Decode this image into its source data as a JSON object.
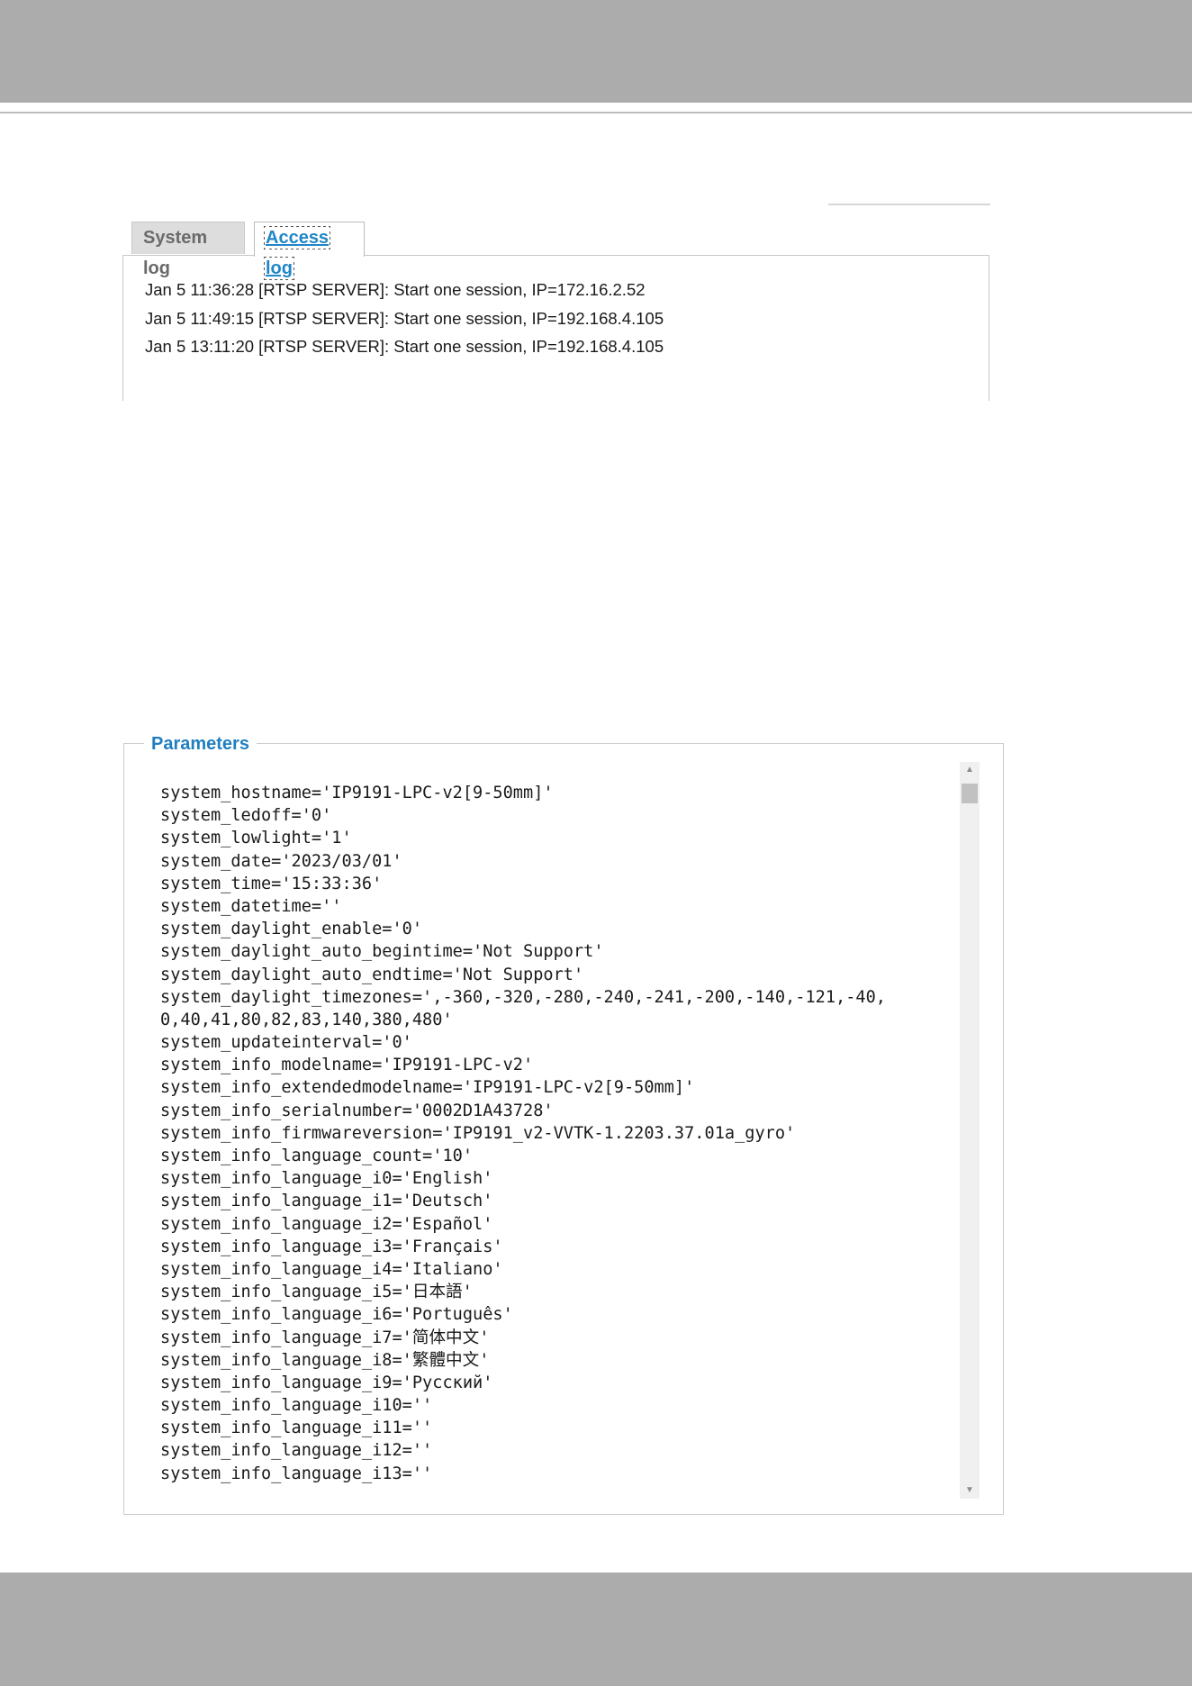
{
  "tabs": {
    "system_log": "System log",
    "access_log": "Access log"
  },
  "log_entries": [
    "Jan 5 11:36:28 [RTSP SERVER]: Start one session, IP=172.16.2.52",
    "Jan 5 11:49:15 [RTSP SERVER]: Start one session, IP=192.168.4.105",
    "Jan 5 13:11:20 [RTSP SERVER]: Start one session, IP=192.168.4.105"
  ],
  "parameters": {
    "legend": "Parameters",
    "lines": [
      "system_hostname='IP9191-LPC-v2[9-50mm]'",
      "system_ledoff='0'",
      "system_lowlight='1'",
      "system_date='2023/03/01'",
      "system_time='15:33:36'",
      "system_datetime=''",
      "system_daylight_enable='0'",
      "system_daylight_auto_begintime='Not Support'",
      "system_daylight_auto_endtime='Not Support'",
      "system_daylight_timezones=',-360,-320,-280,-240,-241,-200,-140,-121,-40,",
      "0,40,41,80,82,83,140,380,480'",
      "system_updateinterval='0'",
      "system_info_modelname='IP9191-LPC-v2'",
      "system_info_extendedmodelname='IP9191-LPC-v2[9-50mm]'",
      "system_info_serialnumber='0002D1A43728'",
      "system_info_firmwareversion='IP9191_v2-VVTK-1.2203.37.01a_gyro'",
      "system_info_language_count='10'",
      "system_info_language_i0='English'",
      "system_info_language_i1='Deutsch'",
      "system_info_language_i2='Español'",
      "system_info_language_i3='Français'",
      "system_info_language_i4='Italiano'",
      "system_info_language_i5='日本語'",
      "system_info_language_i6='Português'",
      "system_info_language_i7='简体中文'",
      "system_info_language_i8='繁體中文'",
      "system_info_language_i9='Русский'",
      "system_info_language_i10=''",
      "system_info_language_i11=''",
      "system_info_language_i12=''",
      "system_info_language_i13=''"
    ]
  },
  "icons": {
    "scroll_up": "triangle-up",
    "scroll_down": "triangle-down"
  },
  "colors": {
    "header_band": "#acacac",
    "accent_blue": "#1f86c8",
    "legend_blue": "#1f7fc0",
    "inactive_tab_bg": "#dddddd"
  }
}
